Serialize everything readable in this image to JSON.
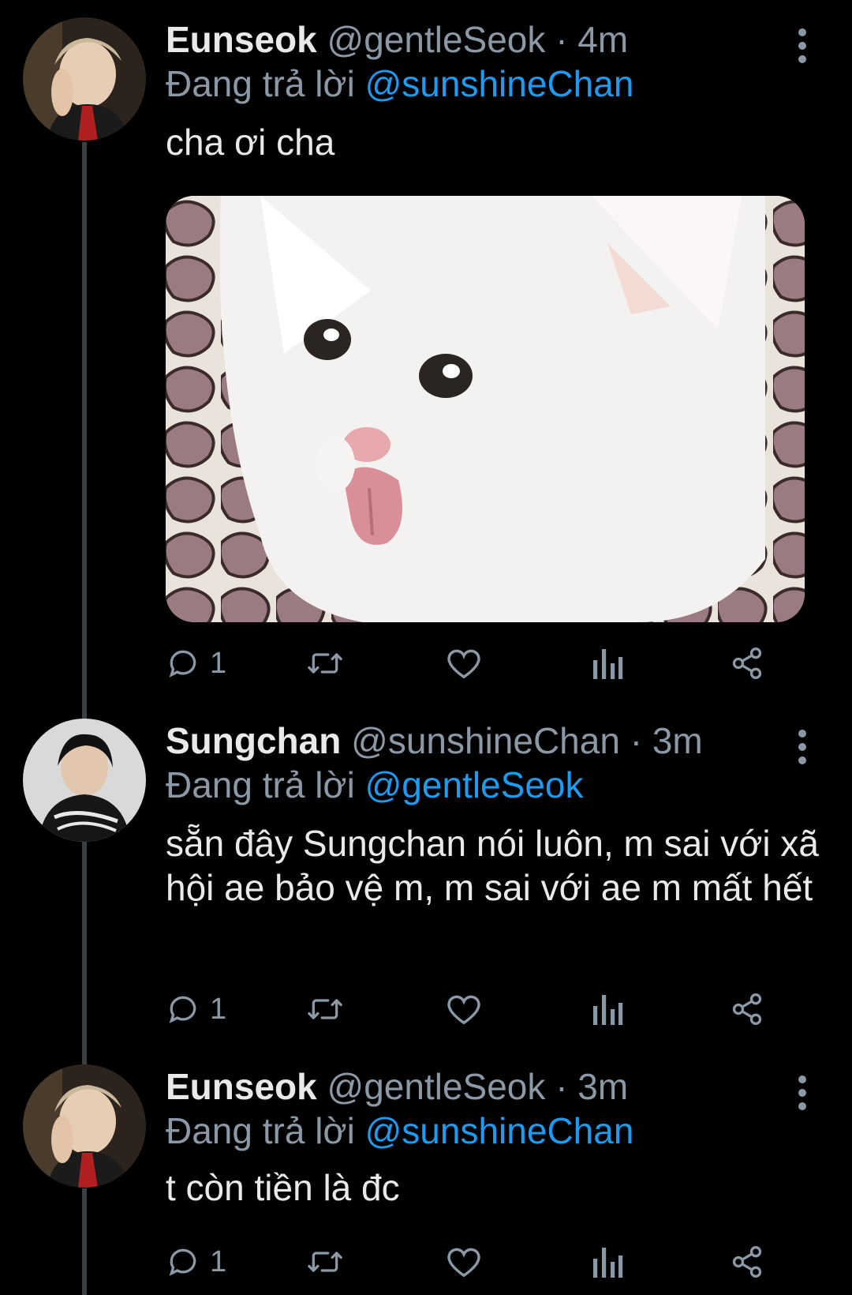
{
  "tweets": [
    {
      "name": "Eunseok",
      "handle": "@gentleSeok",
      "sep": "·",
      "time": "4m",
      "replying_prefix": "Đang trả lời",
      "replying_to": "@sunshineChan",
      "text": "cha ơi cha",
      "has_media": true,
      "reply_count": "1"
    },
    {
      "name": "Sungchan",
      "handle": "@sunshineChan",
      "sep": "·",
      "time": "3m",
      "replying_prefix": "Đang trả lời",
      "replying_to": "@gentleSeok",
      "text": "sẵn đây Sungchan nói luôn, m sai với xã hội ae bảo vệ m, m sai với ae m mất hết",
      "has_media": false,
      "reply_count": "1"
    },
    {
      "name": "Eunseok",
      "handle": "@gentleSeok",
      "sep": "·",
      "time": "3m",
      "replying_prefix": "Đang trả lời",
      "replying_to": "@sunshineChan",
      "text": "t còn tiền là đc",
      "has_media": false,
      "reply_count": "1"
    }
  ],
  "colors": {
    "background": "#000000",
    "primary_text": "#e7e9ea",
    "secondary_text": "#8b98a5",
    "mention": "#1d9bf0",
    "thread_line": "#3a3f44"
  },
  "icons": [
    "reply-icon",
    "retweet-icon",
    "like-icon",
    "views-icon",
    "share-icon",
    "more-icon"
  ]
}
